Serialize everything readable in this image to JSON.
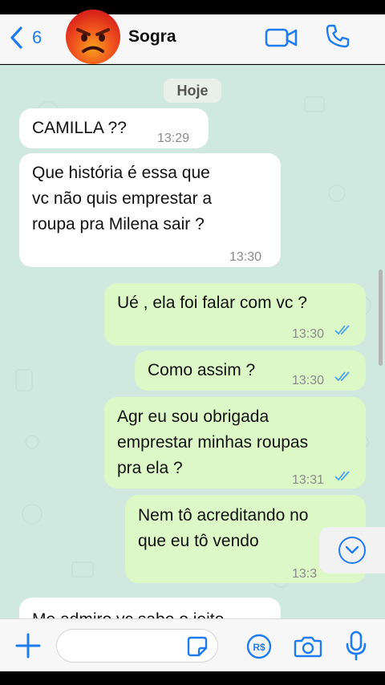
{
  "header": {
    "back_count": "6",
    "contact_name": "Sogra",
    "avatar_emoji": "angry-face"
  },
  "chat": {
    "date_chip": "Hoje",
    "messages": [
      {
        "direction": "in",
        "text_lines": [
          "CAMILLA ??"
        ],
        "time": "13:29"
      },
      {
        "direction": "in",
        "text_lines": [
          "Que história é essa que",
          "vc não quis emprestar a",
          "roupa pra Milena sair ?"
        ],
        "time": "13:30"
      },
      {
        "direction": "out",
        "text_lines": [
          "Ué , ela foi falar com vc ?"
        ],
        "time": "13:30",
        "read": true
      },
      {
        "direction": "out",
        "text_lines": [
          "Como assim ?"
        ],
        "time": "13:30",
        "read": true
      },
      {
        "direction": "out",
        "text_lines": [
          "Agr eu sou obrigada",
          "emprestar minhas roupas",
          "pra ela ?"
        ],
        "time": "13:31",
        "read": true
      },
      {
        "direction": "out",
        "text_lines": [
          "Nem tô acreditando no",
          "que eu tô vendo"
        ],
        "time": "13:3"
      },
      {
        "direction": "in",
        "text_lines": [
          "Me admiro vc sabe o jeito"
        ],
        "time": ""
      }
    ]
  },
  "composer": {
    "placeholder": ""
  },
  "colors": {
    "accent": "#1e7cf2",
    "incoming_bubble": "#ffffff",
    "outgoing_bubble": "#dcf8c6",
    "chat_background": "#cfe9e0"
  }
}
